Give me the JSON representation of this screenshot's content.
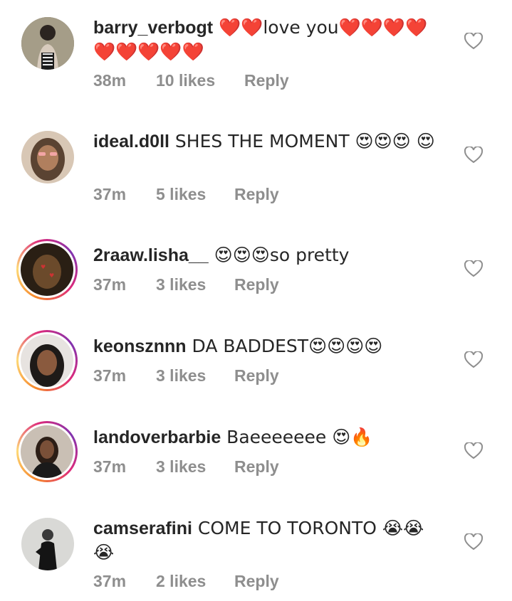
{
  "comments": [
    {
      "username": "barry_verbogt",
      "text": " ❤️❤️love you❤️❤️❤️❤️ ❤️❤️❤️❤️❤️",
      "time": "38m",
      "likes": "10 likes",
      "reply": "Reply"
    },
    {
      "username": "ideal.d0ll",
      "text": " SHES THE MOMENT 😍😍😍 😍",
      "time": "37m",
      "likes": "5 likes",
      "reply": "Reply"
    },
    {
      "username": "2raaw.lisha__",
      "text": " 😍😍😍so pretty",
      "time": "37m",
      "likes": "3 likes",
      "reply": "Reply"
    },
    {
      "username": "keonsznnn",
      "text": " DA BADDEST😍😍😍😍",
      "time": "37m",
      "likes": "3 likes",
      "reply": "Reply"
    },
    {
      "username": "landoverbarbie",
      "text": " Baeeeeeee 😍🔥",
      "time": "37m",
      "likes": "3 likes",
      "reply": "Reply"
    },
    {
      "username": "camserafini",
      "text": " COME TO TORONTO 😭😭 😭",
      "time": "37m",
      "likes": "2 likes",
      "reply": "Reply"
    }
  ]
}
